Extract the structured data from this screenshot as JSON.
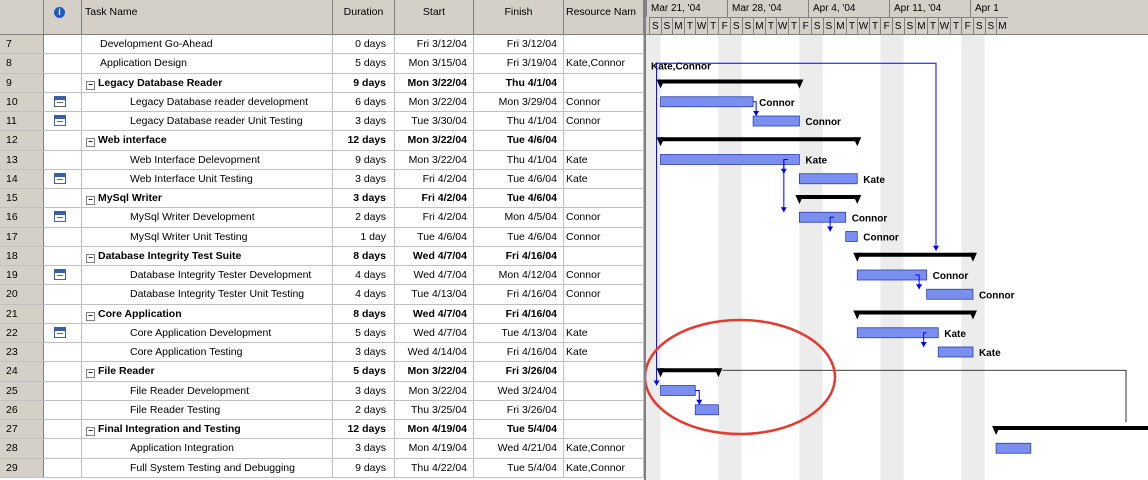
{
  "columns": {
    "indicator_icon": "info-icon",
    "name": "Task Name",
    "duration": "Duration",
    "start": "Start",
    "finish": "Finish",
    "resource": "Resource Nam"
  },
  "timescale": {
    "weeks": [
      "Mar 21, '04",
      "Mar 28, '04",
      "Apr 4, '04",
      "Apr 11, '04",
      "Apr 1"
    ],
    "day_letters": [
      "S",
      "S",
      "M",
      "T",
      "W",
      "T",
      "F",
      "S",
      "S",
      "M",
      "T",
      "W",
      "T",
      "F",
      "S",
      "S",
      "M",
      "T",
      "W",
      "T",
      "F",
      "S",
      "S",
      "M",
      "T",
      "W",
      "T",
      "F",
      "S",
      "S",
      "M"
    ]
  },
  "rows": [
    {
      "id": "7",
      "name": "Development Go-Ahead",
      "duration": "0 days",
      "start": "Fri 3/12/04",
      "finish": "Fri 3/12/04",
      "resource": "",
      "summary": false,
      "level": 1,
      "note": false
    },
    {
      "id": "8",
      "name": "Application Design",
      "duration": "5 days",
      "start": "Mon 3/15/04",
      "finish": "Fri 3/19/04",
      "resource": "Kate,Connor",
      "summary": false,
      "level": 1,
      "note": false
    },
    {
      "id": "9",
      "name": "Legacy Database Reader",
      "duration": "9 days",
      "start": "Mon 3/22/04",
      "finish": "Thu 4/1/04",
      "resource": "",
      "summary": true,
      "level": 1,
      "note": false
    },
    {
      "id": "10",
      "name": "Legacy Database reader development",
      "duration": "6 days",
      "start": "Mon 3/22/04",
      "finish": "Mon 3/29/04",
      "resource": "Connor",
      "summary": false,
      "level": 2,
      "note": true
    },
    {
      "id": "11",
      "name": "Legacy Database reader Unit Testing",
      "duration": "3 days",
      "start": "Tue 3/30/04",
      "finish": "Thu 4/1/04",
      "resource": "Connor",
      "summary": false,
      "level": 2,
      "note": true
    },
    {
      "id": "12",
      "name": "Web interface",
      "duration": "12 days",
      "start": "Mon 3/22/04",
      "finish": "Tue 4/6/04",
      "resource": "",
      "summary": true,
      "level": 1,
      "note": false
    },
    {
      "id": "13",
      "name": "Web Interface Delevopment",
      "duration": "9 days",
      "start": "Mon 3/22/04",
      "finish": "Thu 4/1/04",
      "resource": "Kate",
      "summary": false,
      "level": 2,
      "note": false
    },
    {
      "id": "14",
      "name": "Web Interface Unit Testing",
      "duration": "3 days",
      "start": "Fri 4/2/04",
      "finish": "Tue 4/6/04",
      "resource": "Kate",
      "summary": false,
      "level": 2,
      "note": true
    },
    {
      "id": "15",
      "name": "MySql Writer",
      "duration": "3 days",
      "start": "Fri 4/2/04",
      "finish": "Tue 4/6/04",
      "resource": "",
      "summary": true,
      "level": 1,
      "note": false
    },
    {
      "id": "16",
      "name": "MySql Writer Development",
      "duration": "2 days",
      "start": "Fri 4/2/04",
      "finish": "Mon 4/5/04",
      "resource": "Connor",
      "summary": false,
      "level": 2,
      "note": true
    },
    {
      "id": "17",
      "name": "MySql Writer Unit Testing",
      "duration": "1 day",
      "start": "Tue 4/6/04",
      "finish": "Tue 4/6/04",
      "resource": "Connor",
      "summary": false,
      "level": 2,
      "note": false
    },
    {
      "id": "18",
      "name": "Database Integrity Test Suite",
      "duration": "8 days",
      "start": "Wed 4/7/04",
      "finish": "Fri 4/16/04",
      "resource": "",
      "summary": true,
      "level": 1,
      "note": false
    },
    {
      "id": "19",
      "name": "Database Integrity Tester Development",
      "duration": "4 days",
      "start": "Wed 4/7/04",
      "finish": "Mon 4/12/04",
      "resource": "Connor",
      "summary": false,
      "level": 2,
      "note": true
    },
    {
      "id": "20",
      "name": "Database Integrity Tester Unit Testing",
      "duration": "4 days",
      "start": "Tue 4/13/04",
      "finish": "Fri 4/16/04",
      "resource": "Connor",
      "summary": false,
      "level": 2,
      "note": false
    },
    {
      "id": "21",
      "name": "Core Application",
      "duration": "8 days",
      "start": "Wed 4/7/04",
      "finish": "Fri 4/16/04",
      "resource": "",
      "summary": true,
      "level": 1,
      "note": false
    },
    {
      "id": "22",
      "name": "Core Application Development",
      "duration": "5 days",
      "start": "Wed 4/7/04",
      "finish": "Tue 4/13/04",
      "resource": "Kate",
      "summary": false,
      "level": 2,
      "note": true
    },
    {
      "id": "23",
      "name": "Core Application Testing",
      "duration": "3 days",
      "start": "Wed 4/14/04",
      "finish": "Fri 4/16/04",
      "resource": "Kate",
      "summary": false,
      "level": 2,
      "note": false
    },
    {
      "id": "24",
      "name": "File Reader",
      "duration": "5 days",
      "start": "Mon 3/22/04",
      "finish": "Fri 3/26/04",
      "resource": "",
      "summary": true,
      "level": 1,
      "note": false
    },
    {
      "id": "25",
      "name": "File Reader Development",
      "duration": "3 days",
      "start": "Mon 3/22/04",
      "finish": "Wed 3/24/04",
      "resource": "",
      "summary": false,
      "level": 2,
      "note": false
    },
    {
      "id": "26",
      "name": "File Reader Testing",
      "duration": "2 days",
      "start": "Thu 3/25/04",
      "finish": "Fri 3/26/04",
      "resource": "",
      "summary": false,
      "level": 2,
      "note": false
    },
    {
      "id": "27",
      "name": "Final Integration and Testing",
      "duration": "12 days",
      "start": "Mon 4/19/04",
      "finish": "Tue 5/4/04",
      "resource": "",
      "summary": true,
      "level": 1,
      "note": false
    },
    {
      "id": "28",
      "name": "Application Integration",
      "duration": "3 days",
      "start": "Mon 4/19/04",
      "finish": "Wed 4/21/04",
      "resource": "Kate,Connor",
      "summary": false,
      "level": 2,
      "note": false
    },
    {
      "id": "29",
      "name": "Full System Testing and Debugging",
      "duration": "9 days",
      "start": "Thu 4/22/04",
      "finish": "Tue 5/4/04",
      "resource": "Kate,Connor",
      "summary": false,
      "level": 2,
      "note": false
    }
  ],
  "gantt_labels": {
    "r8": "Kate,Connor",
    "r10": "Connor",
    "r11": "Connor",
    "r13": "Kate",
    "r14": "Kate",
    "r16": "Connor",
    "r17": "Connor",
    "r19": "Connor",
    "r20": "Connor",
    "r22": "Kate",
    "r23": "Kate"
  },
  "colors": {
    "task_bar": "#7b8ff0",
    "summary_bar": "#000000",
    "link": "#0000ff",
    "highlight_circle": "#e53a2f",
    "header_bg": "#d4d0c8"
  }
}
